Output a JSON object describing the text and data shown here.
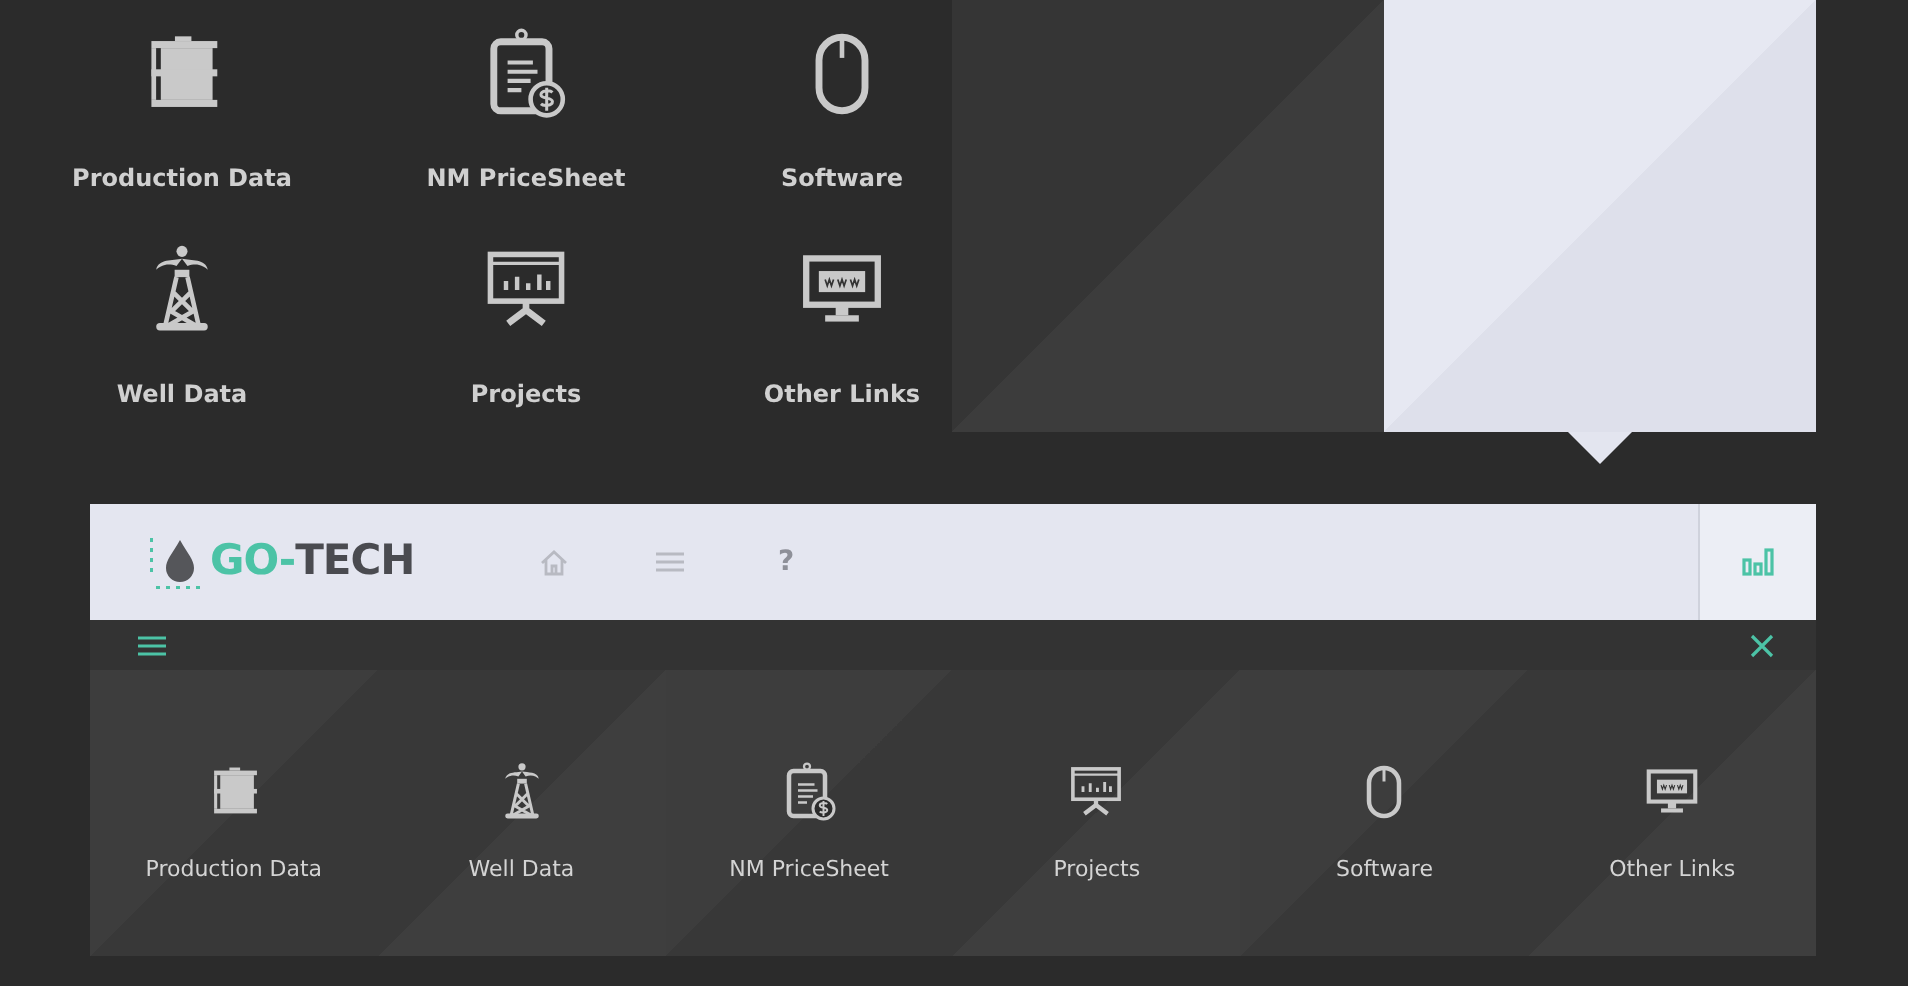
{
  "launcher": {
    "tiles": [
      {
        "label": "Production Data"
      },
      {
        "label": "NM PriceSheet"
      },
      {
        "label": "Software"
      },
      {
        "label": "Well Data"
      },
      {
        "label": "Projects"
      },
      {
        "label": "Other Links"
      }
    ]
  },
  "header": {
    "logo": {
      "accent": "GO-",
      "text": "TECH"
    },
    "nav": [
      {
        "kind": "home"
      },
      {
        "kind": "menu"
      },
      {
        "kind": "help",
        "label": "?"
      }
    ]
  },
  "menu": {
    "tiles": [
      {
        "label": "Production Data"
      },
      {
        "label": "Well Data"
      },
      {
        "label": "NM PriceSheet"
      },
      {
        "label": "Projects"
      },
      {
        "label": "Software"
      },
      {
        "label": "Other Links"
      }
    ]
  }
}
